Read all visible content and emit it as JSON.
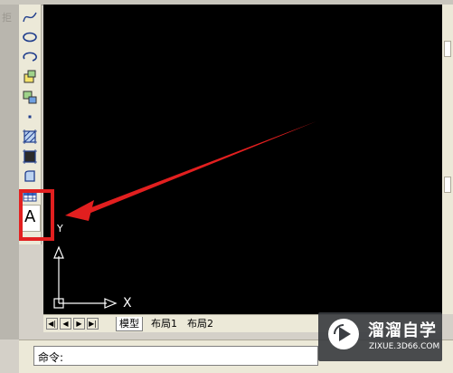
{
  "app": {
    "left_panel_hint": "拒"
  },
  "toolbar": {
    "tools": [
      {
        "name": "spline-icon"
      },
      {
        "name": "ellipse-icon"
      },
      {
        "name": "ellipse-arc-icon"
      },
      {
        "name": "insert-block-icon"
      },
      {
        "name": "make-block-icon"
      },
      {
        "name": "point-icon"
      },
      {
        "name": "hatch-icon"
      },
      {
        "name": "gradient-icon"
      },
      {
        "name": "region-icon"
      },
      {
        "name": "table-icon"
      }
    ],
    "text_tool_label": "A"
  },
  "canvas": {
    "background": "#000000",
    "ucs_x_label": "X",
    "ucs_y_label": "Y"
  },
  "tabs": {
    "nav": [
      "◀|",
      "◀",
      "▶",
      "▶|"
    ],
    "items": [
      {
        "label": "模型",
        "active": true
      },
      {
        "label": "布局1",
        "active": false
      },
      {
        "label": "布局2",
        "active": false
      }
    ]
  },
  "command": {
    "prompt": "命令:"
  },
  "annotation": {
    "color": "#e21f1f"
  },
  "watermark": {
    "brand": "溜溜自学",
    "site": "ZIXUE.3D66.COM"
  }
}
